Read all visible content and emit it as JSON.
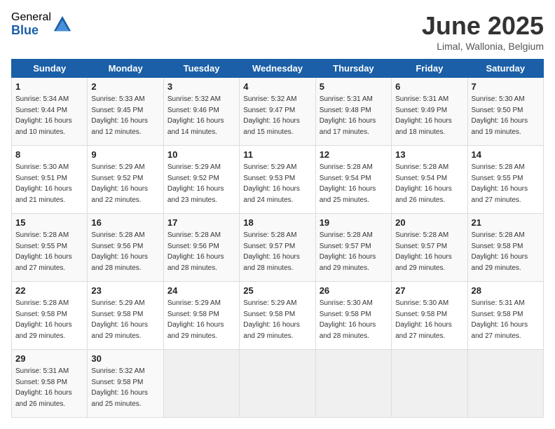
{
  "header": {
    "logo_general": "General",
    "logo_blue": "Blue",
    "month_title": "June 2025",
    "location": "Limal, Wallonia, Belgium"
  },
  "days_of_week": [
    "Sunday",
    "Monday",
    "Tuesday",
    "Wednesday",
    "Thursday",
    "Friday",
    "Saturday"
  ],
  "weeks": [
    [
      {
        "day": "1",
        "sunrise": "Sunrise: 5:34 AM",
        "sunset": "Sunset: 9:44 PM",
        "daylight": "Daylight: 16 hours and 10 minutes."
      },
      {
        "day": "2",
        "sunrise": "Sunrise: 5:33 AM",
        "sunset": "Sunset: 9:45 PM",
        "daylight": "Daylight: 16 hours and 12 minutes."
      },
      {
        "day": "3",
        "sunrise": "Sunrise: 5:32 AM",
        "sunset": "Sunset: 9:46 PM",
        "daylight": "Daylight: 16 hours and 14 minutes."
      },
      {
        "day": "4",
        "sunrise": "Sunrise: 5:32 AM",
        "sunset": "Sunset: 9:47 PM",
        "daylight": "Daylight: 16 hours and 15 minutes."
      },
      {
        "day": "5",
        "sunrise": "Sunrise: 5:31 AM",
        "sunset": "Sunset: 9:48 PM",
        "daylight": "Daylight: 16 hours and 17 minutes."
      },
      {
        "day": "6",
        "sunrise": "Sunrise: 5:31 AM",
        "sunset": "Sunset: 9:49 PM",
        "daylight": "Daylight: 16 hours and 18 minutes."
      },
      {
        "day": "7",
        "sunrise": "Sunrise: 5:30 AM",
        "sunset": "Sunset: 9:50 PM",
        "daylight": "Daylight: 16 hours and 19 minutes."
      }
    ],
    [
      {
        "day": "8",
        "sunrise": "Sunrise: 5:30 AM",
        "sunset": "Sunset: 9:51 PM",
        "daylight": "Daylight: 16 hours and 21 minutes."
      },
      {
        "day": "9",
        "sunrise": "Sunrise: 5:29 AM",
        "sunset": "Sunset: 9:52 PM",
        "daylight": "Daylight: 16 hours and 22 minutes."
      },
      {
        "day": "10",
        "sunrise": "Sunrise: 5:29 AM",
        "sunset": "Sunset: 9:52 PM",
        "daylight": "Daylight: 16 hours and 23 minutes."
      },
      {
        "day": "11",
        "sunrise": "Sunrise: 5:29 AM",
        "sunset": "Sunset: 9:53 PM",
        "daylight": "Daylight: 16 hours and 24 minutes."
      },
      {
        "day": "12",
        "sunrise": "Sunrise: 5:28 AM",
        "sunset": "Sunset: 9:54 PM",
        "daylight": "Daylight: 16 hours and 25 minutes."
      },
      {
        "day": "13",
        "sunrise": "Sunrise: 5:28 AM",
        "sunset": "Sunset: 9:54 PM",
        "daylight": "Daylight: 16 hours and 26 minutes."
      },
      {
        "day": "14",
        "sunrise": "Sunrise: 5:28 AM",
        "sunset": "Sunset: 9:55 PM",
        "daylight": "Daylight: 16 hours and 27 minutes."
      }
    ],
    [
      {
        "day": "15",
        "sunrise": "Sunrise: 5:28 AM",
        "sunset": "Sunset: 9:55 PM",
        "daylight": "Daylight: 16 hours and 27 minutes."
      },
      {
        "day": "16",
        "sunrise": "Sunrise: 5:28 AM",
        "sunset": "Sunset: 9:56 PM",
        "daylight": "Daylight: 16 hours and 28 minutes."
      },
      {
        "day": "17",
        "sunrise": "Sunrise: 5:28 AM",
        "sunset": "Sunset: 9:56 PM",
        "daylight": "Daylight: 16 hours and 28 minutes."
      },
      {
        "day": "18",
        "sunrise": "Sunrise: 5:28 AM",
        "sunset": "Sunset: 9:57 PM",
        "daylight": "Daylight: 16 hours and 28 minutes."
      },
      {
        "day": "19",
        "sunrise": "Sunrise: 5:28 AM",
        "sunset": "Sunset: 9:57 PM",
        "daylight": "Daylight: 16 hours and 29 minutes."
      },
      {
        "day": "20",
        "sunrise": "Sunrise: 5:28 AM",
        "sunset": "Sunset: 9:57 PM",
        "daylight": "Daylight: 16 hours and 29 minutes."
      },
      {
        "day": "21",
        "sunrise": "Sunrise: 5:28 AM",
        "sunset": "Sunset: 9:58 PM",
        "daylight": "Daylight: 16 hours and 29 minutes."
      }
    ],
    [
      {
        "day": "22",
        "sunrise": "Sunrise: 5:28 AM",
        "sunset": "Sunset: 9:58 PM",
        "daylight": "Daylight: 16 hours and 29 minutes."
      },
      {
        "day": "23",
        "sunrise": "Sunrise: 5:29 AM",
        "sunset": "Sunset: 9:58 PM",
        "daylight": "Daylight: 16 hours and 29 minutes."
      },
      {
        "day": "24",
        "sunrise": "Sunrise: 5:29 AM",
        "sunset": "Sunset: 9:58 PM",
        "daylight": "Daylight: 16 hours and 29 minutes."
      },
      {
        "day": "25",
        "sunrise": "Sunrise: 5:29 AM",
        "sunset": "Sunset: 9:58 PM",
        "daylight": "Daylight: 16 hours and 29 minutes."
      },
      {
        "day": "26",
        "sunrise": "Sunrise: 5:30 AM",
        "sunset": "Sunset: 9:58 PM",
        "daylight": "Daylight: 16 hours and 28 minutes."
      },
      {
        "day": "27",
        "sunrise": "Sunrise: 5:30 AM",
        "sunset": "Sunset: 9:58 PM",
        "daylight": "Daylight: 16 hours and 27 minutes."
      },
      {
        "day": "28",
        "sunrise": "Sunrise: 5:31 AM",
        "sunset": "Sunset: 9:58 PM",
        "daylight": "Daylight: 16 hours and 27 minutes."
      }
    ],
    [
      {
        "day": "29",
        "sunrise": "Sunrise: 5:31 AM",
        "sunset": "Sunset: 9:58 PM",
        "daylight": "Daylight: 16 hours and 26 minutes."
      },
      {
        "day": "30",
        "sunrise": "Sunrise: 5:32 AM",
        "sunset": "Sunset: 9:58 PM",
        "daylight": "Daylight: 16 hours and 25 minutes."
      },
      {
        "day": "",
        "sunrise": "",
        "sunset": "",
        "daylight": ""
      },
      {
        "day": "",
        "sunrise": "",
        "sunset": "",
        "daylight": ""
      },
      {
        "day": "",
        "sunrise": "",
        "sunset": "",
        "daylight": ""
      },
      {
        "day": "",
        "sunrise": "",
        "sunset": "",
        "daylight": ""
      },
      {
        "day": "",
        "sunrise": "",
        "sunset": "",
        "daylight": ""
      }
    ]
  ]
}
